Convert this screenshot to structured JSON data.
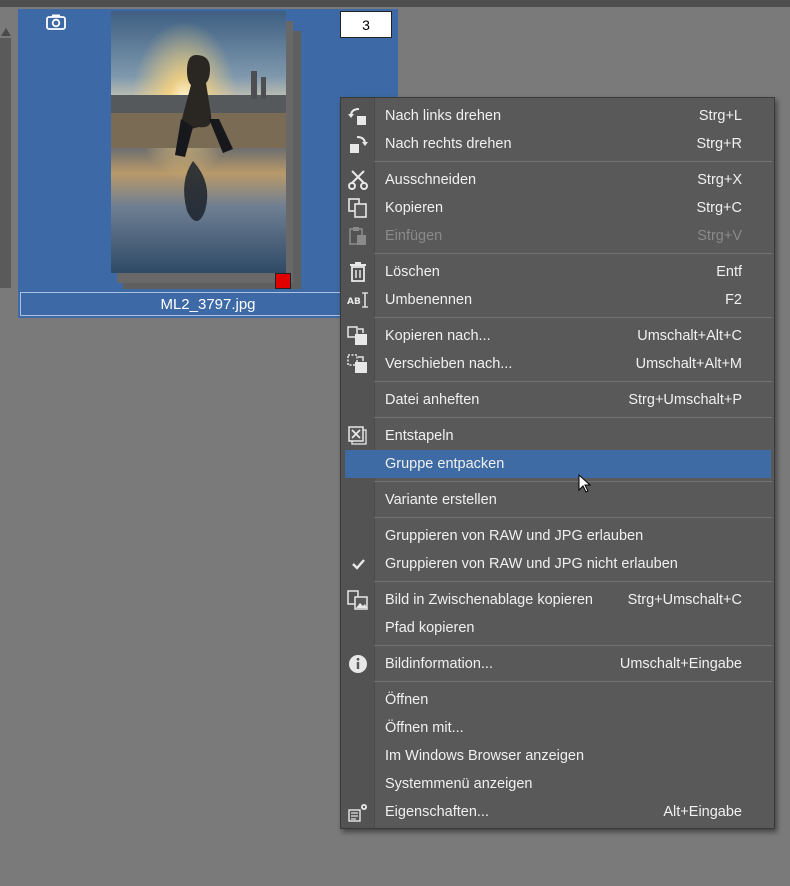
{
  "thumbnail": {
    "filename": "ML2_3797.jpg",
    "stack_count": "3",
    "camera_icon": "camera-icon",
    "edit_icon": "edit-settings-icon",
    "flag_color": "#e00000",
    "selection_color": "#3d6aa6"
  },
  "context_menu": {
    "highlight_color": "#3e6ba3",
    "items": [
      {
        "label": "Nach links drehen",
        "shortcut": "Strg+L",
        "icon": "rotate-left-icon"
      },
      {
        "label": "Nach rechts drehen",
        "shortcut": "Strg+R",
        "icon": "rotate-right-icon"
      },
      {
        "label": "Ausschneiden",
        "shortcut": "Strg+X",
        "icon": "scissors-icon"
      },
      {
        "label": "Kopieren",
        "shortcut": "Strg+C",
        "icon": "copy-icon"
      },
      {
        "label": "Einfügen",
        "shortcut": "Strg+V",
        "icon": "paste-icon",
        "disabled": true
      },
      {
        "label": "Löschen",
        "shortcut": "Entf",
        "icon": "trash-icon"
      },
      {
        "label": "Umbenennen",
        "shortcut": "F2",
        "icon": "rename-icon"
      },
      {
        "label": "Kopieren nach...",
        "shortcut": "Umschalt+Alt+C",
        "icon": "copy-to-icon"
      },
      {
        "label": "Verschieben nach...",
        "shortcut": "Umschalt+Alt+M",
        "icon": "move-to-icon"
      },
      {
        "label": "Datei anheften",
        "shortcut": "Strg+Umschalt+P"
      },
      {
        "label": "Entstapeln",
        "shortcut": "",
        "icon": "unstack-icon"
      },
      {
        "label": "Gruppe entpacken",
        "shortcut": "",
        "highlighted": true
      },
      {
        "label": "Variante erstellen",
        "shortcut": ""
      },
      {
        "label": "Gruppieren von RAW und JPG erlauben",
        "shortcut": ""
      },
      {
        "label": "Gruppieren von RAW und JPG nicht erlauben",
        "shortcut": "",
        "icon": "checkmark-icon",
        "checked": true
      },
      {
        "label": "Bild in Zwischenablage kopieren",
        "shortcut": "Strg+Umschalt+C",
        "icon": "clipboard-image-icon"
      },
      {
        "label": "Pfad kopieren",
        "shortcut": ""
      },
      {
        "label": "Bildinformation...",
        "shortcut": "Umschalt+Eingabe",
        "icon": "info-icon"
      },
      {
        "label": "Öffnen",
        "shortcut": ""
      },
      {
        "label": "Öffnen mit...",
        "shortcut": ""
      },
      {
        "label": "Im Windows Browser anzeigen",
        "shortcut": ""
      },
      {
        "label": "Systemmenü anzeigen",
        "shortcut": ""
      },
      {
        "label": "Eigenschaften...",
        "shortcut": "Alt+Eingabe",
        "icon": "properties-icon"
      }
    ]
  }
}
